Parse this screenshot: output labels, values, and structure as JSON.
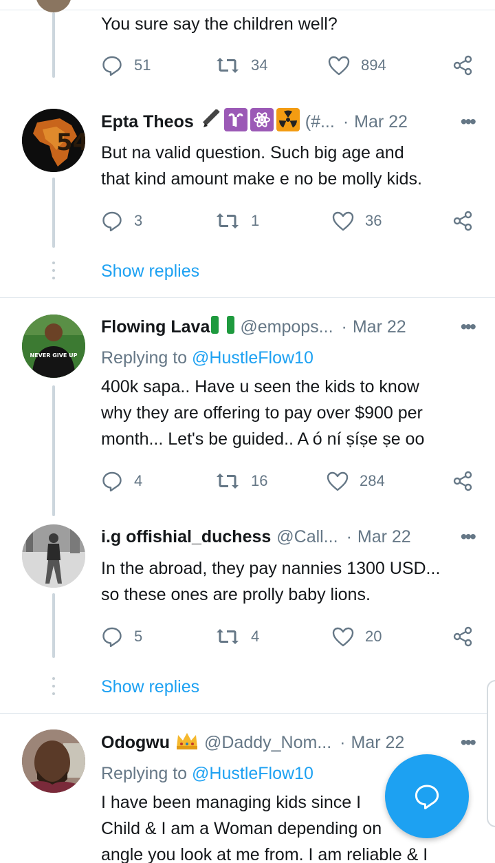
{
  "tweets": [
    {
      "text": [
        "You sure say the children well?"
      ],
      "actions": {
        "replies": "51",
        "retweets": "34",
        "likes": "894"
      }
    },
    {
      "name": "Epta Theos",
      "handle": "(#...",
      "dot": "·",
      "date": "Mar 22",
      "more": "•••",
      "text": [
        "But na valid question. Such big age and",
        "that kind amount make e no be molly kids."
      ],
      "actions": {
        "replies": "3",
        "retweets": "1",
        "likes": "36"
      },
      "show_replies": "Show replies"
    },
    {
      "name": "Flowing Lava",
      "handle": "@empops...",
      "dot": "·",
      "date": "Mar 22",
      "more": "•••",
      "reply_prefix": "Replying to",
      "reply_mention": "@HustleFlow10",
      "avatar_shirt": "NEVER GIVE UP",
      "text": [
        "400k sapa.. Have u seen the kids to know",
        "why they are offering to pay over $900 per",
        "month... Let's be guided.. A ó ní ṣíṣe ṣe oo"
      ],
      "actions": {
        "replies": "4",
        "retweets": "16",
        "likes": "284"
      }
    },
    {
      "name": "i.g offishial_duchess",
      "handle": "@Call...",
      "dot": "·",
      "date": "Mar 22",
      "more": "•••",
      "text": [
        "In the abroad, they pay nannies 1300 USD...",
        "so these ones are prolly baby lions."
      ],
      "actions": {
        "replies": "5",
        "retweets": "4",
        "likes": "20"
      },
      "show_replies": "Show replies"
    },
    {
      "name": "Odogwu",
      "handle": "@Daddy_Nom...",
      "dot": "·",
      "date": "Mar 22",
      "more": "•••",
      "reply_prefix": "Replying to",
      "reply_mention": "@HustleFlow10",
      "text": [
        "I have been managing kids since I",
        "Child & I am a Woman depending on",
        "angle you look at me from. I am reliable & I"
      ]
    }
  ],
  "colors": {
    "accent": "#1da1f2",
    "secondary_text": "#657786",
    "thread_line": "#ccd6dd"
  }
}
